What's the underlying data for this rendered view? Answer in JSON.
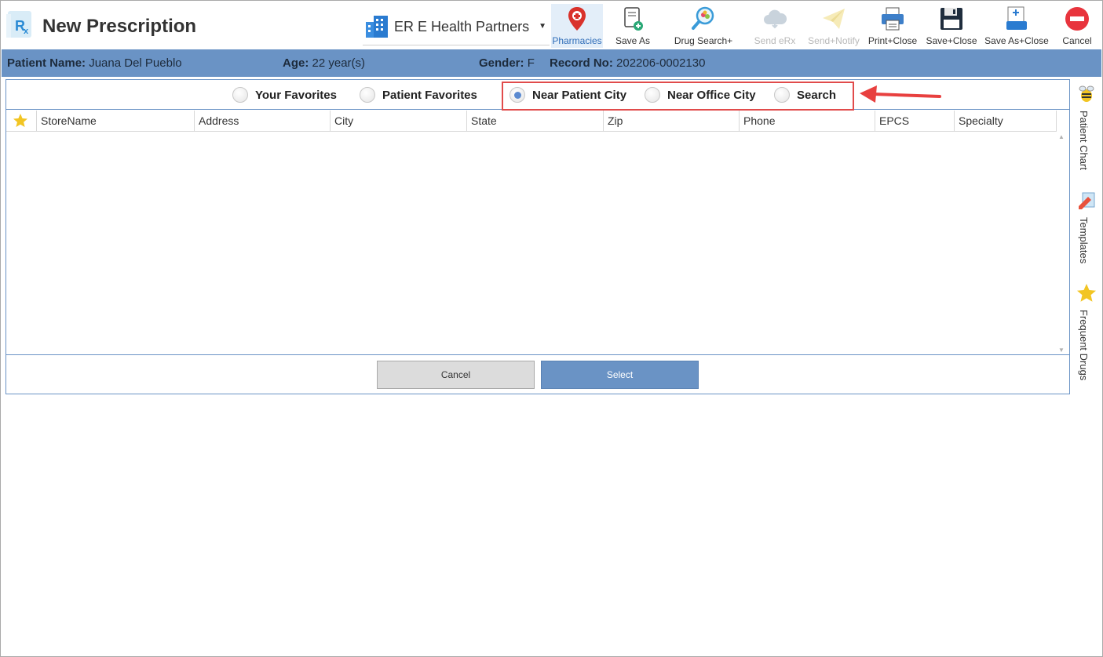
{
  "window": {
    "title": "New Prescription"
  },
  "practice": {
    "name": "ER E Health Partners"
  },
  "toolbar": [
    {
      "key": "pharmacies",
      "label": "Pharmacies",
      "icon": "map-pin-icon",
      "state": "active"
    },
    {
      "key": "save_as",
      "label": "Save As",
      "icon": "document-add-icon",
      "state": "normal"
    },
    {
      "key": "drug_search",
      "label": "Drug Search+",
      "icon": "magnifier-pills-icon",
      "state": "normal"
    },
    {
      "key": "send_erx",
      "label": "Send eRx",
      "icon": "cloud-icon",
      "state": "disabled"
    },
    {
      "key": "send_notify",
      "label": "Send+Notify",
      "icon": "paper-plane-icon",
      "state": "disabled"
    },
    {
      "key": "print_close",
      "label": "Print+Close",
      "icon": "printer-icon",
      "state": "normal"
    },
    {
      "key": "save_close",
      "label": "Save+Close",
      "icon": "floppy-disk-icon",
      "state": "normal"
    },
    {
      "key": "save_as_close",
      "label": "Save As+Close",
      "icon": "document-save-icon",
      "state": "normal"
    },
    {
      "key": "cancel",
      "label": "Cancel",
      "icon": "no-entry-icon",
      "state": "normal"
    }
  ],
  "patient": {
    "name_label": "Patient Name:",
    "name": "Juana Del Pueblo",
    "age_label": "Age:",
    "age": "22 year(s)",
    "gender_label": "Gender:",
    "gender": "F",
    "record_label": "Record No:",
    "record": "202206-0002130"
  },
  "filters": [
    {
      "label": "Your Favorites",
      "selected": false
    },
    {
      "label": "Patient Favorites",
      "selected": false
    },
    {
      "label": "Near Patient City",
      "selected": true
    },
    {
      "label": "Near Office City",
      "selected": false
    },
    {
      "label": "Search",
      "selected": false
    }
  ],
  "columns": [
    "StoreName",
    "Address",
    "City",
    "State",
    "Zip",
    "Phone",
    "EPCS",
    "Specialty"
  ],
  "rows": [],
  "buttons": {
    "cancel": "Cancel",
    "select": "Select"
  },
  "side_tabs": [
    {
      "label": "Patient Chart",
      "icon": "bee-icon"
    },
    {
      "label": "Templates",
      "icon": "pencil-template-icon"
    },
    {
      "label": "Frequent Drugs",
      "icon": "star-icon"
    }
  ],
  "colors": {
    "accent": "#6a93c5",
    "highlight": "#e14b4b"
  }
}
